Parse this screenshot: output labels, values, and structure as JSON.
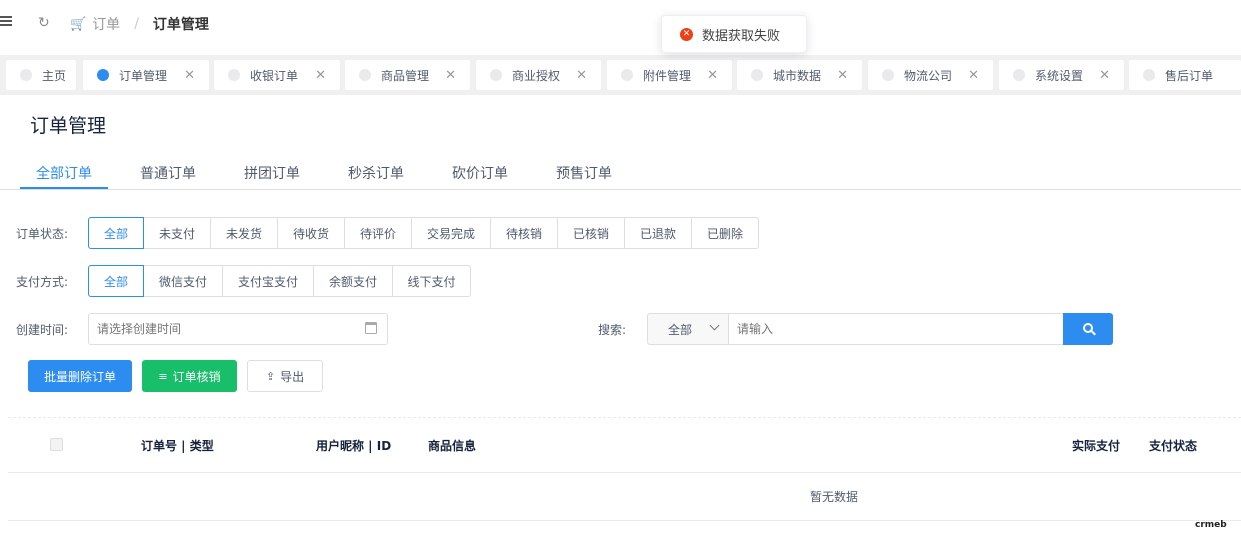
{
  "header": {
    "breadcrumb_first": "订单",
    "breadcrumb_sep": "/",
    "breadcrumb_current": "订单管理"
  },
  "toast": {
    "message": "数据获取失败",
    "icon": "error-icon"
  },
  "tabs": [
    {
      "label": "主页",
      "active": false,
      "closable": false
    },
    {
      "label": "订单管理",
      "active": true,
      "closable": true
    },
    {
      "label": "收银订单",
      "active": false,
      "closable": true
    },
    {
      "label": "商品管理",
      "active": false,
      "closable": true
    },
    {
      "label": "商业授权",
      "active": false,
      "closable": true
    },
    {
      "label": "附件管理",
      "active": false,
      "closable": true
    },
    {
      "label": "城市数据",
      "active": false,
      "closable": true
    },
    {
      "label": "物流公司",
      "active": false,
      "closable": true
    },
    {
      "label": "系统设置",
      "active": false,
      "closable": true
    },
    {
      "label": "售后订单",
      "active": false,
      "closable": true
    }
  ],
  "page_title": "订单管理",
  "order_types": [
    "全部订单",
    "普通订单",
    "拼团订单",
    "秒杀订单",
    "砍价订单",
    "预售订单"
  ],
  "active_order_type": "全部订单",
  "filters": {
    "status_label": "订单状态:",
    "status_options": [
      "全部",
      "未支付",
      "未发货",
      "待收货",
      "待评价",
      "交易完成",
      "待核销",
      "已核销",
      "已退款",
      "已删除"
    ],
    "status_selected": "全部",
    "pay_label": "支付方式:",
    "pay_options": [
      "全部",
      "微信支付",
      "支付宝支付",
      "余额支付",
      "线下支付"
    ],
    "pay_selected": "全部",
    "date_label": "创建时间:",
    "date_placeholder": "请选择创建时间",
    "search_label": "搜索:",
    "search_select_value": "全部",
    "search_placeholder": "请输入"
  },
  "actions": {
    "batch_delete": "批量删除订单",
    "verify": "订单核销",
    "export": "导出"
  },
  "table": {
    "columns": [
      "订单号 | 类型",
      "用户昵称 | ID",
      "商品信息",
      "实际支付",
      "支付状态"
    ],
    "empty_text": "暂无数据"
  },
  "watermark": "crmeb",
  "colors": {
    "primary": "#2d8cf0",
    "success": "#19be6b",
    "error": "#ed4014"
  }
}
